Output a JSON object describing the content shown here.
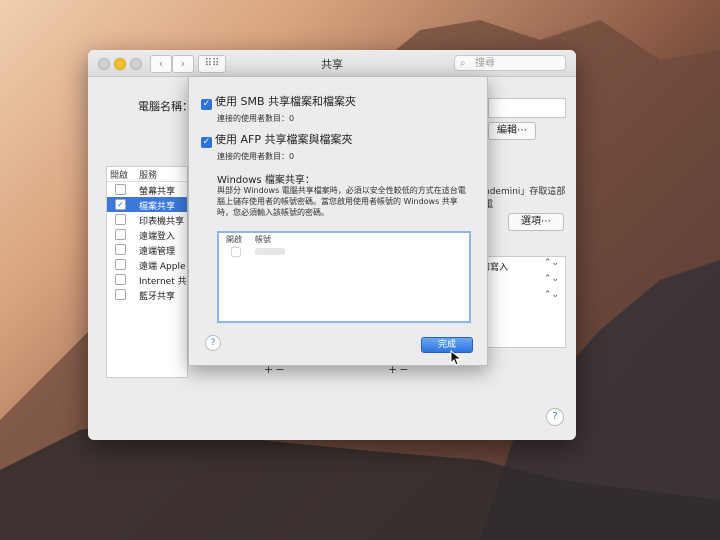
{
  "window": {
    "title": "共享",
    "search_placeholder": "搜尋"
  },
  "main": {
    "computer_name_label": "電腦名稱：",
    "edit_button": "編輯⋯",
    "right_description": "ndemini」存取這部電",
    "options_button": "選項⋯",
    "service_list": {
      "header_on": "開啟",
      "header_service": "服務",
      "items": [
        {
          "label": "螢幕共享",
          "checked": false,
          "selected": false
        },
        {
          "label": "檔案共享",
          "checked": true,
          "selected": true
        },
        {
          "label": "印表機共享",
          "checked": false,
          "selected": false
        },
        {
          "label": "遠端登入",
          "checked": false,
          "selected": false
        },
        {
          "label": "遠端管理",
          "checked": false,
          "selected": false
        },
        {
          "label": "遠端 Apple",
          "checked": false,
          "selected": false
        },
        {
          "label": "Internet 共",
          "checked": false,
          "selected": false
        },
        {
          "label": "藍牙共享",
          "checked": false,
          "selected": false
        }
      ]
    },
    "permissions": [
      {
        "label": "和寫入"
      },
      {
        "label": ""
      },
      {
        "label": ""
      }
    ],
    "plus_minus": "+−",
    "help": "?"
  },
  "sheet": {
    "smb_label": "使用 SMB 共享檔案和檔案夾",
    "smb_users": "連接的使用者數目：0",
    "afp_label": "使用 AFP 共享檔案與檔案夾",
    "afp_users": "連接的使用者數目：0",
    "windows_heading": "Windows 檔案共享：",
    "windows_description": "與部分 Windows 電腦共享檔案時，必須以安全性較低的方式在這台電腦上儲存使用者的帳號密碼。當您啟用使用者帳號的 Windows 共享時，您必須輸入該帳號的密碼。",
    "table_header_on": "開啟",
    "table_header_account": "帳號",
    "help": "?",
    "done_button": "完成"
  },
  "colors": {
    "accent": "#2e72d6",
    "selection": "#3b78d8"
  }
}
